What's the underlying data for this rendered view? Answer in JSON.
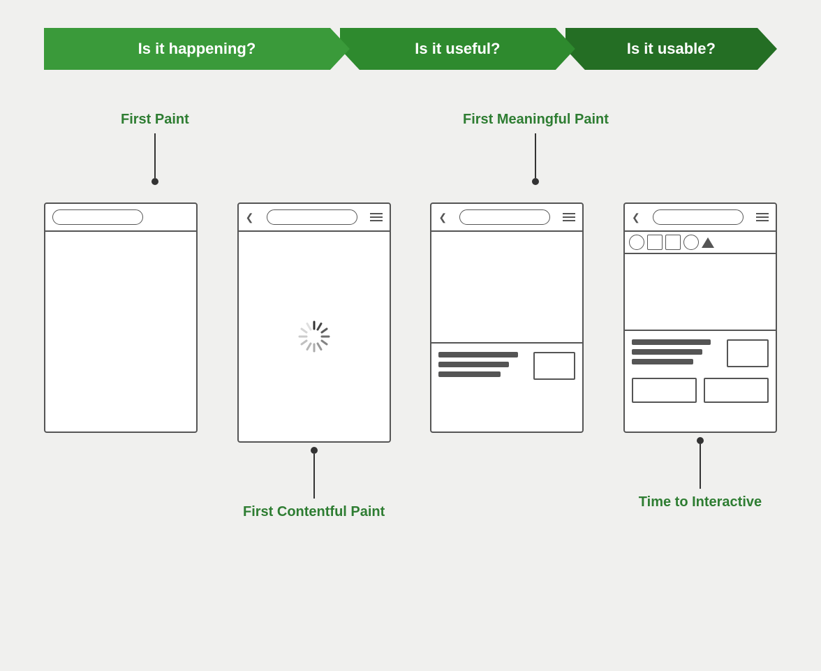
{
  "banner": {
    "segment1": "Is it happening?",
    "segment2": "Is it useful?",
    "segment3": "Is it usable?"
  },
  "labels": {
    "first_paint": "First Paint",
    "fmp": "First Meaningful Paint",
    "fcp": "First Contentful Paint",
    "tti": "Time to Interactive"
  },
  "phones": [
    {
      "id": "phone1",
      "type": "first-paint",
      "description": "Empty page with search bar"
    },
    {
      "id": "phone2",
      "type": "loading",
      "description": "Loading spinner"
    },
    {
      "id": "phone3",
      "type": "fmp",
      "description": "Content area visible"
    },
    {
      "id": "phone4",
      "type": "interactive",
      "description": "Fully interactive"
    }
  ],
  "colors": {
    "green_light": "#3a9a3a",
    "green_mid": "#2e8a2e",
    "green_dark": "#246e24",
    "green_label": "#2e7d32",
    "background": "#f0f0ee",
    "border": "#555555"
  }
}
